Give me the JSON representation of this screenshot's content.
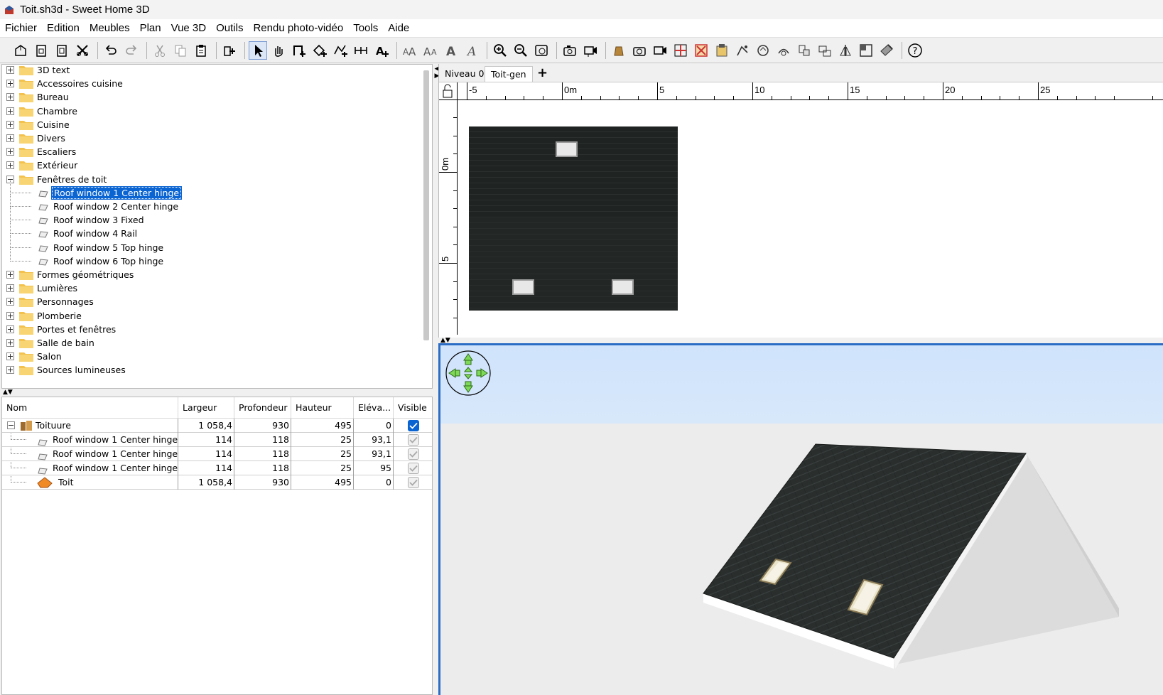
{
  "window": {
    "title": "Toit.sh3d - Sweet Home 3D"
  },
  "menu": [
    "Fichier",
    "Edition",
    "Meubles",
    "Plan",
    "Vue 3D",
    "Outils",
    "Rendu photo-vidéo",
    "Tools",
    "Aide"
  ],
  "toolbar": {
    "icons": [
      "new-home-icon",
      "new-from-template-icon",
      "open-icon",
      "preferences-icon",
      "undo-icon",
      "redo-icon",
      "cut-icon",
      "copy-icon",
      "paste-icon",
      "add-furniture-icon",
      "select-icon",
      "pan-icon",
      "create-walls-icon",
      "create-rooms-icon",
      "create-polylines-icon",
      "create-dimensions-icon",
      "add-text-icon",
      "increase-text-size-icon",
      "decrease-text-size-icon",
      "bold-text-icon",
      "italic-text-icon",
      "zoom-in-icon",
      "zoom-out-icon",
      "zoom-fit-icon",
      "create-photo-icon",
      "create-video-icon",
      "import-furniture-icon",
      "import-texture-icon",
      "export-icon",
      "roof-icon",
      "help-icon"
    ]
  },
  "catalog": {
    "categories": [
      {
        "label": "3D text",
        "expanded": false
      },
      {
        "label": "Accessoires cuisine",
        "expanded": false
      },
      {
        "label": "Bureau",
        "expanded": false
      },
      {
        "label": "Chambre",
        "expanded": false
      },
      {
        "label": "Cuisine",
        "expanded": false
      },
      {
        "label": "Divers",
        "expanded": false
      },
      {
        "label": "Escaliers",
        "expanded": false
      },
      {
        "label": "Extérieur",
        "expanded": false
      },
      {
        "label": "Fenêtres de toit",
        "expanded": true
      },
      {
        "label": "Formes géométriques",
        "expanded": false
      },
      {
        "label": "Lumières",
        "expanded": false
      },
      {
        "label": "Personnages",
        "expanded": false
      },
      {
        "label": "Plomberie",
        "expanded": false
      },
      {
        "label": "Portes et fenêtres",
        "expanded": false
      },
      {
        "label": "Salle de bain",
        "expanded": false
      },
      {
        "label": "Salon",
        "expanded": false
      },
      {
        "label": "Sources lumineuses",
        "expanded": false
      }
    ],
    "roof_windows": [
      {
        "label": "Roof window 1 Center hinge",
        "selected": true
      },
      {
        "label": "Roof window 2 Center hinge",
        "selected": false
      },
      {
        "label": "Roof window 3 Fixed",
        "selected": false
      },
      {
        "label": "Roof window 4 Rail",
        "selected": false
      },
      {
        "label": "Roof window 5 Top hinge",
        "selected": false
      },
      {
        "label": "Roof window 6 Top hinge",
        "selected": false
      }
    ]
  },
  "furniture_table": {
    "headers": [
      "Nom",
      "Largeur",
      "Profondeur",
      "Hauteur",
      "Eléva...",
      "Visible"
    ],
    "rows": [
      {
        "name": "Toituure",
        "width": "1 058,4",
        "depth": "930",
        "height": "495",
        "elevation": "0",
        "visible": true,
        "group": true
      },
      {
        "name": "Roof window 1 Center hinge",
        "width": "114",
        "depth": "118",
        "height": "25",
        "elevation": "93,1",
        "visible": false
      },
      {
        "name": "Roof window 1 Center hinge",
        "width": "114",
        "depth": "118",
        "height": "25",
        "elevation": "93,1",
        "visible": false
      },
      {
        "name": "Roof window 1 Center hinge",
        "width": "114",
        "depth": "118",
        "height": "25",
        "elevation": "95",
        "visible": false
      },
      {
        "name": "Toit",
        "width": "1 058,4",
        "depth": "930",
        "height": "495",
        "elevation": "0",
        "visible": false
      }
    ]
  },
  "plan": {
    "tabs": [
      "Niveau 0",
      "Toit-gen"
    ],
    "add_tab_label": "+",
    "ruler_top_labels": [
      "-5",
      "0m",
      "5",
      "10",
      "15",
      "20",
      "25"
    ],
    "ruler_left_labels": [
      "0m",
      "5"
    ]
  },
  "colors": {
    "selection": "#0a64d2",
    "roof_dark": "#1d2020",
    "sky": "#cfe3fb",
    "ground": "#ececec"
  }
}
